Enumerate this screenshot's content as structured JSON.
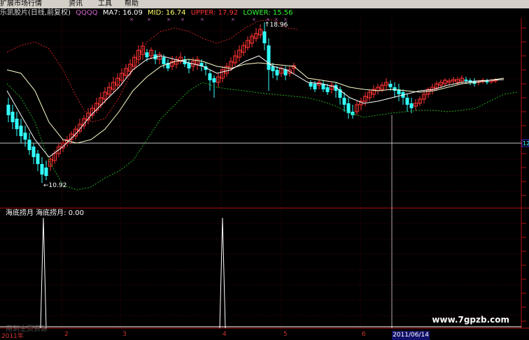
{
  "menu": [
    {
      "label": "扩展市场行情"
    },
    {
      "label": "资讯"
    },
    {
      "label": "工具"
    },
    {
      "label": "帮助"
    }
  ],
  "header": {
    "name": "乐凯胶片(日线,前复权)",
    "code": "QQQQ",
    "ma7": "MA7: 16.09",
    "mid": "MID: 16.74",
    "upper": "UPPER: 17.92",
    "lower": "LOWER: 15.56"
  },
  "indicator": {
    "title": "海底捞月",
    "value_label": "海底捞月: 0.00"
  },
  "chart_data": {
    "type": "candlestick",
    "high_label": "18.96",
    "low_label": "10.92",
    "right_edge_label": "12",
    "x_labels": [
      "2011年",
      "2",
      "3",
      "4",
      "5",
      "6"
    ],
    "cursor_date": "2011/06/14",
    "colors": {
      "up": "#ff3333",
      "down": "#33ffff",
      "mid": "#ffffcc",
      "upper": "#cc2222",
      "lower": "#22aa22",
      "white": "#ffffff"
    }
  },
  "watermark": "www.7gpzb.com",
  "faint_text": "用到主页资源"
}
